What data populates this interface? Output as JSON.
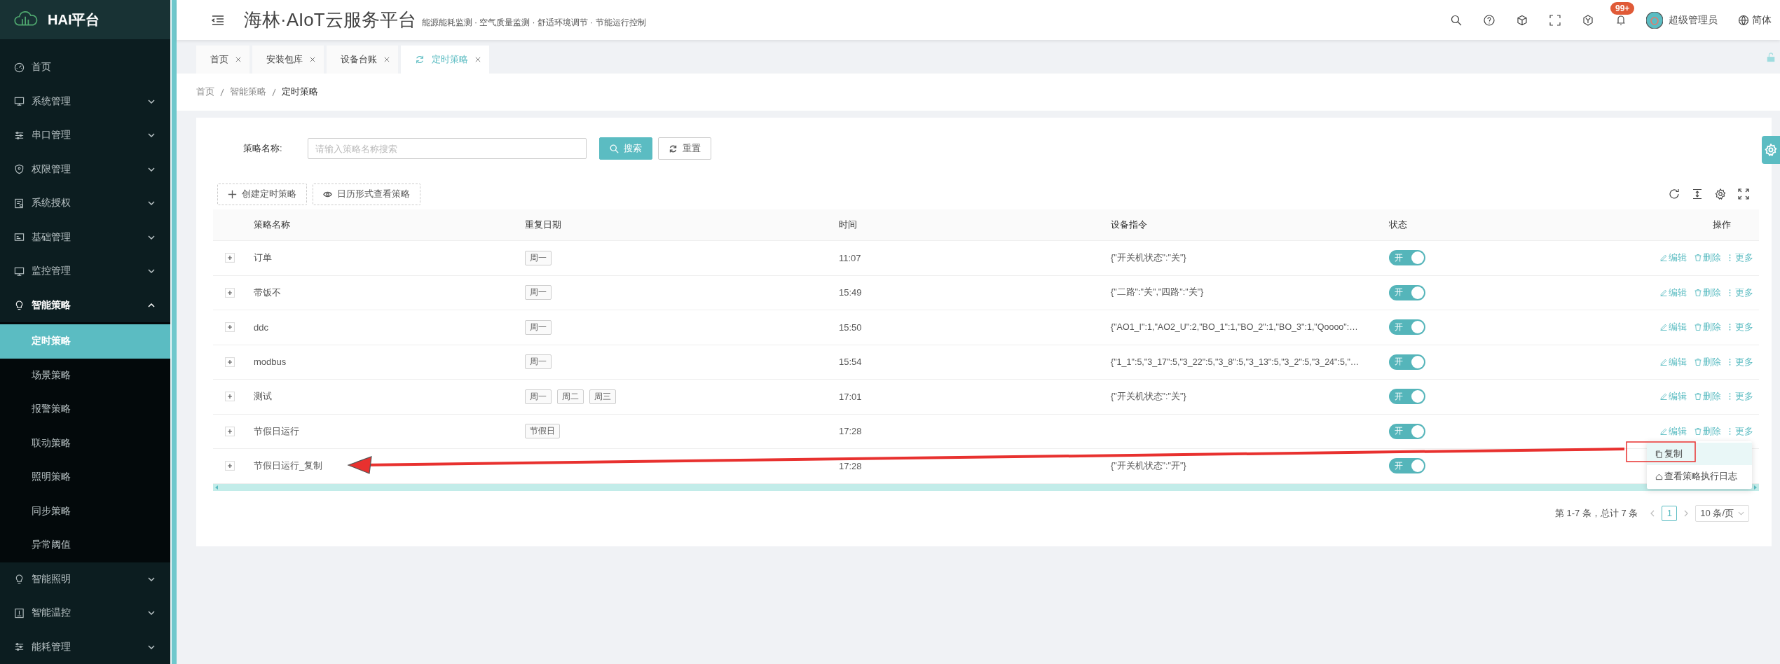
{
  "brand": {
    "name": "HAI平台"
  },
  "sidebar": {
    "items": [
      {
        "kind": "link",
        "label": "首页"
      },
      {
        "kind": "group",
        "label": "系统管理",
        "expanded": false
      },
      {
        "kind": "group",
        "label": "串口管理",
        "expanded": false
      },
      {
        "kind": "group",
        "label": "权限管理",
        "expanded": false
      },
      {
        "kind": "group",
        "label": "系统授权",
        "expanded": false
      },
      {
        "kind": "group",
        "label": "基础管理",
        "expanded": false
      },
      {
        "kind": "group",
        "label": "监控管理",
        "expanded": false
      },
      {
        "kind": "group",
        "label": "智能策略",
        "expanded": true,
        "children": [
          {
            "label": "定时策略",
            "selected": true
          },
          {
            "label": "场景策略",
            "selected": false
          },
          {
            "label": "报警策略",
            "selected": false
          },
          {
            "label": "联动策略",
            "selected": false
          },
          {
            "label": "照明策略",
            "selected": false
          },
          {
            "label": "同步策略",
            "selected": false
          },
          {
            "label": "异常阈值",
            "selected": false
          }
        ]
      },
      {
        "kind": "group",
        "label": "智能照明",
        "expanded": false
      },
      {
        "kind": "group",
        "label": "智能温控",
        "expanded": false
      },
      {
        "kind": "group",
        "label": "能耗管理",
        "expanded": false
      }
    ]
  },
  "header": {
    "title": "海林·AIoT云服务平台",
    "subtitle": "能源能耗监测 · 空气质量监测 · 舒适环境调节 · 节能运行控制",
    "notification_badge": "99+",
    "user": "超级管理员",
    "language": "简体"
  },
  "tabs": [
    {
      "label": "首页",
      "selected": false
    },
    {
      "label": "安装包库",
      "selected": false
    },
    {
      "label": "设备台账",
      "selected": false
    },
    {
      "label": "定时策略",
      "selected": true
    }
  ],
  "breadcrumb": [
    "首页",
    "智能策略",
    "定时策略"
  ],
  "search": {
    "label": "策略名称:",
    "placeholder": "请输入策略名称搜索",
    "search_button": "搜索",
    "reset_button": "重置"
  },
  "toolbar": {
    "create_button": "创建定时策略",
    "calendar_button": "日历形式查看策略"
  },
  "table": {
    "columns": [
      "策略名称",
      "重复日期",
      "时间",
      "设备指令",
      "状态",
      "操作"
    ],
    "rows": [
      {
        "name": "订单",
        "days": [
          "周一"
        ],
        "time": "11:07",
        "command": "{\"开关机状态\":\"关\"}",
        "enabled": true,
        "status_label": "开",
        "actions": [
          "编辑",
          "删除",
          "更多"
        ]
      },
      {
        "name": "带饭不",
        "days": [
          "周一"
        ],
        "time": "15:49",
        "command": "{\"二路\":\"关\",\"四路\":\"关\"}",
        "enabled": true,
        "status_label": "开",
        "actions": [
          "编辑",
          "删除",
          "更多"
        ]
      },
      {
        "name": "ddc",
        "days": [
          "周一"
        ],
        "time": "15:50",
        "command": "{\"AO1_I\":1,\"AO2_U\":2,\"BO_1\":1,\"BO_2\":1,\"BO_3\":1,\"Qoooo\":…",
        "enabled": true,
        "status_label": "开",
        "actions": [
          "编辑",
          "删除",
          "更多"
        ]
      },
      {
        "name": "modbus",
        "days": [
          "周一"
        ],
        "time": "15:54",
        "command": "{\"1_1\":5,\"3_17\":5,\"3_22\":5,\"3_8\":5,\"3_13\":5,\"3_2\":5,\"3_24\":5,\"…",
        "enabled": true,
        "status_label": "开",
        "actions": [
          "编辑",
          "删除",
          "更多"
        ]
      },
      {
        "name": "测试",
        "days": [
          "周一",
          "周二",
          "周三"
        ],
        "time": "17:01",
        "command": "{\"开关机状态\":\"关\"}",
        "enabled": true,
        "status_label": "开",
        "actions": [
          "编辑",
          "删除",
          "更多"
        ]
      },
      {
        "name": "节假日运行",
        "days": [
          "节假日"
        ],
        "time": "17:28",
        "enabled": true,
        "status_label": "开",
        "actions": [
          "编辑",
          "删除",
          "更多"
        ]
      },
      {
        "name": "节假日运行_复制",
        "time": "17:28",
        "command": "{\"开关机状态\":\"开\"}",
        "enabled": true,
        "status_label": "开"
      }
    ]
  },
  "dropdown": {
    "items": [
      {
        "label": "复制",
        "selected": true
      },
      {
        "label": "查看策略执行日志",
        "selected": false
      }
    ]
  },
  "pagination": {
    "summary": "第 1-7 条，总计 7 条",
    "pages": [
      {
        "label": "1",
        "selected": true
      }
    ],
    "page_size": "10 条/页"
  }
}
